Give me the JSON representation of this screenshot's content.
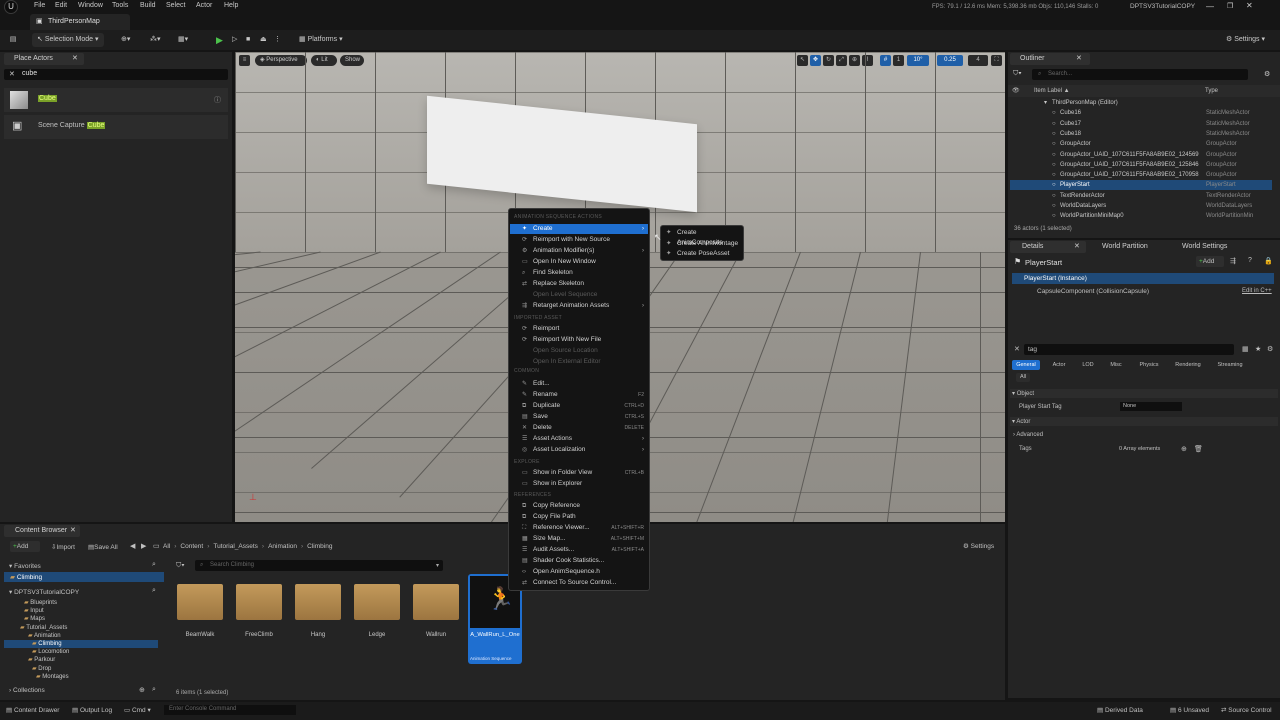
{
  "menubar": {
    "items": [
      "File",
      "Edit",
      "Window",
      "Tools",
      "Build",
      "Select",
      "Actor",
      "Help"
    ]
  },
  "tab": {
    "map": "ThirdPersonMap"
  },
  "perf": {
    "text": "FPS: 79.1  / 12.6 ms   Mem: 5,398.36 mb   Objs: 110,146   Stalls: 0",
    "project": "DPTSV3TutorialCOPY"
  },
  "toolbar": {
    "selection_mode": "Selection Mode",
    "platforms": "Platforms",
    "settings": "Settings"
  },
  "place_actors": {
    "tab": "Place Actors",
    "search": "cube",
    "items": [
      {
        "pre": "",
        "hl": "Cube"
      },
      {
        "pre": "Scene Capture ",
        "hl": "Cube"
      }
    ]
  },
  "viewport": {
    "perspective": "Perspective",
    "lit": "Lit",
    "show": "Show",
    "snap_angle": "10°",
    "snap_scale": "0.25",
    "cam_speed": "4",
    "grid": "1"
  },
  "outliner": {
    "tab": "Outliner",
    "search_placeholder": "Search...",
    "col_label": "Item Label ▲",
    "col_type": "Type",
    "rows": [
      {
        "label": "ThirdPersonMap (Editor)",
        "type": ""
      },
      {
        "label": "Cube16",
        "type": "StaticMeshActor"
      },
      {
        "label": "Cube17",
        "type": "StaticMeshActor"
      },
      {
        "label": "Cube18",
        "type": "StaticMeshActor"
      },
      {
        "label": "GroupActor",
        "type": "GroupActor"
      },
      {
        "label": "GroupActor_UAID_107C611F5FA8AB9E02_124569",
        "type": "GroupActor"
      },
      {
        "label": "GroupActor_UAID_107C611F5FA8AB9E02_125846",
        "type": "GroupActor"
      },
      {
        "label": "GroupActor_UAID_107C611F5FA8AB9E02_170958",
        "type": "GroupActor"
      },
      {
        "label": "PlayerStart",
        "type": "PlayerStart"
      },
      {
        "label": "TextRenderActor",
        "type": "TextRenderActor"
      },
      {
        "label": "WorldDataLayers",
        "type": "WorldDataLayers"
      },
      {
        "label": "WorldPartitionMiniMap0",
        "type": "WorldPartitionMin"
      }
    ],
    "footer": "36 actors (1 selected)"
  },
  "details": {
    "tabs": [
      "Details",
      "World Partition",
      "World Settings"
    ],
    "actor": "PlayerStart",
    "add": "Add",
    "instance": "PlayerStart (Instance)",
    "component": "CapsuleComponent (CollisionCapsule)",
    "edit_cpp": "Edit in C++",
    "search": "tag",
    "filters": [
      "General",
      "Actor",
      "LOD",
      "Misc",
      "Physics",
      "Rendering",
      "Streaming"
    ],
    "all": "All",
    "sec_object": "Object",
    "player_start_tag": "Player Start Tag",
    "tag_value": "None",
    "sec_actor": "Actor",
    "advanced": "Advanced",
    "tags": "Tags",
    "tags_value": "0 Array elements"
  },
  "content_browser": {
    "tab": "Content Browser",
    "add": "Add",
    "import": "Import",
    "save_all": "Save All",
    "settings": "Settings",
    "path": [
      "All",
      "Content",
      "Tutorial_Assets",
      "Animation",
      "Climbing"
    ],
    "search_placeholder": "Search Climbing",
    "favorites": "Favorites",
    "fav_item": "Climbing",
    "project": "DPTSV3TutorialCOPY",
    "tree": [
      "Blueprints",
      "Input",
      "Maps",
      "Tutorial_Assets",
      "Animation",
      "Climbing",
      "Locomotion",
      "Parkour",
      "Drop",
      "Montages"
    ],
    "folders": [
      "BeamWalk",
      "FreeClimb",
      "Hang",
      "Ledge",
      "Wallrun"
    ],
    "asset": {
      "name": "A_WallRun_L_One",
      "type": "Animation Sequence"
    },
    "count": "6 items (1 selected)",
    "collections": "Collections"
  },
  "context_menu": {
    "sections": [
      "ANIMATION SEQUENCE ACTIONS",
      "IMPORTED ASSET",
      "COMMON",
      "EXPLORE",
      "REFERENCES"
    ],
    "items": [
      {
        "label": "Create",
        "shortcut": ""
      },
      {
        "label": "Reimport with New Source",
        "shortcut": ""
      },
      {
        "label": "Animation Modifier(s)",
        "shortcut": ""
      },
      {
        "label": "Open In New Window",
        "shortcut": ""
      },
      {
        "label": "Find Skeleton",
        "shortcut": ""
      },
      {
        "label": "Replace Skeleton",
        "shortcut": ""
      },
      {
        "label": "Open Level Sequence",
        "shortcut": ""
      },
      {
        "label": "Retarget Animation Assets",
        "shortcut": ""
      },
      {
        "label": "Reimport",
        "shortcut": ""
      },
      {
        "label": "Reimport With New File",
        "shortcut": ""
      },
      {
        "label": "Open Source Location",
        "shortcut": ""
      },
      {
        "label": "Open In External Editor",
        "shortcut": ""
      },
      {
        "label": "Edit...",
        "shortcut": ""
      },
      {
        "label": "Rename",
        "shortcut": "F2"
      },
      {
        "label": "Duplicate",
        "shortcut": "CTRL+D"
      },
      {
        "label": "Save",
        "shortcut": "CTRL+S"
      },
      {
        "label": "Delete",
        "shortcut": "DELETE"
      },
      {
        "label": "Asset Actions",
        "shortcut": ""
      },
      {
        "label": "Asset Localization",
        "shortcut": ""
      },
      {
        "label": "Show in Folder View",
        "shortcut": "CTRL+B"
      },
      {
        "label": "Show in Explorer",
        "shortcut": ""
      },
      {
        "label": "Copy Reference",
        "shortcut": ""
      },
      {
        "label": "Copy File Path",
        "shortcut": ""
      },
      {
        "label": "Reference Viewer...",
        "shortcut": "ALT+SHIFT+R"
      },
      {
        "label": "Size Map...",
        "shortcut": "ALT+SHIFT+M"
      },
      {
        "label": "Audit Assets...",
        "shortcut": "ALT+SHIFT+A"
      },
      {
        "label": "Shader Cook Statistics...",
        "shortcut": ""
      },
      {
        "label": "Open AnimSequence.h",
        "shortcut": ""
      },
      {
        "label": "Connect To Source Control...",
        "shortcut": ""
      }
    ],
    "submenu": [
      "Create AnimComposite",
      "Create AnimMontage",
      "Create PoseAsset"
    ]
  },
  "statusbar": {
    "drawer": "Content Drawer",
    "output": "Output Log",
    "cmd": "Cmd",
    "console_placeholder": "Enter Console Command",
    "derived": "Derived Data",
    "unsaved": "6 Unsaved",
    "source": "Source Control"
  }
}
